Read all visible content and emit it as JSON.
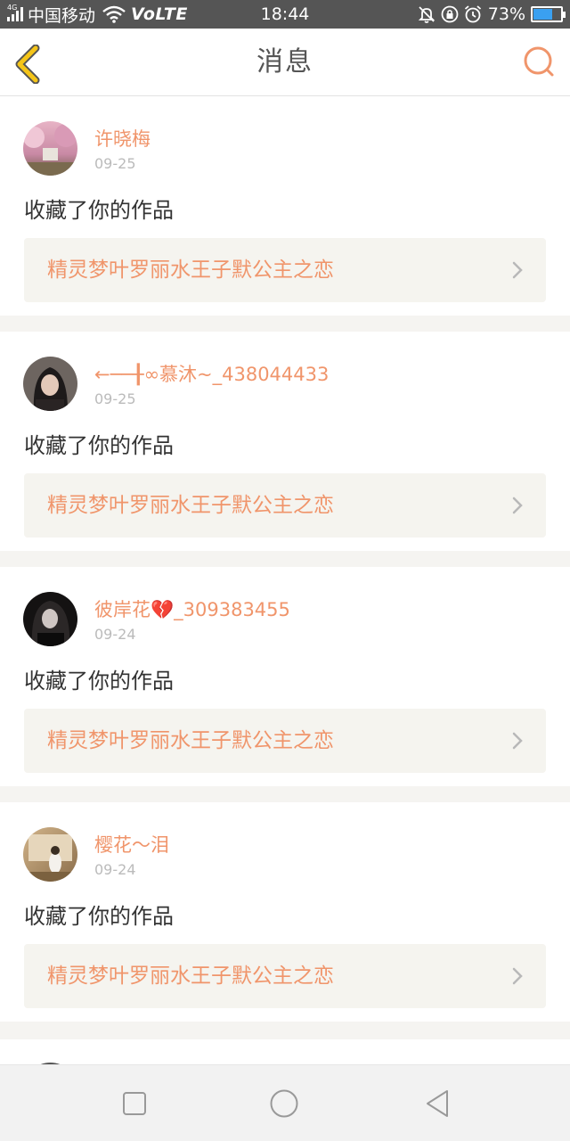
{
  "status_bar": {
    "network": "4G",
    "carrier": "中国移动",
    "volte": "VoLTE",
    "time": "18:44",
    "battery_percent": "73%",
    "battery_level": 0.73,
    "icons": [
      "signal-icon",
      "wifi-icon",
      "mute-icon",
      "rotation-lock-icon",
      "alarm-icon",
      "battery-icon"
    ]
  },
  "header": {
    "title": "消息",
    "back_icon": "chevron-left-icon",
    "search_icon": "search-icon",
    "accent": "#f0956b",
    "back_color": "#f5c518"
  },
  "messages": [
    {
      "username": "许晓梅",
      "date": "09-25",
      "action": "收藏了你的作品",
      "work_title": "精灵梦叶罗丽水王子默公主之恋"
    },
    {
      "username": "←──╂∞慕沐~_438044433",
      "date": "09-25",
      "action": "收藏了你的作品",
      "work_title": "精灵梦叶罗丽水王子默公主之恋"
    },
    {
      "username": "彼岸花💔_309383455",
      "date": "09-24",
      "action": "收藏了你的作品",
      "work_title": "精灵梦叶罗丽水王子默公主之恋"
    },
    {
      "username": "樱花～泪",
      "date": "09-24",
      "action": "收藏了你的作品",
      "work_title": "精灵梦叶罗丽水王子默公主之恋"
    }
  ],
  "nav_bar": {
    "buttons": [
      "recent-apps-icon",
      "home-icon",
      "back-icon"
    ]
  }
}
